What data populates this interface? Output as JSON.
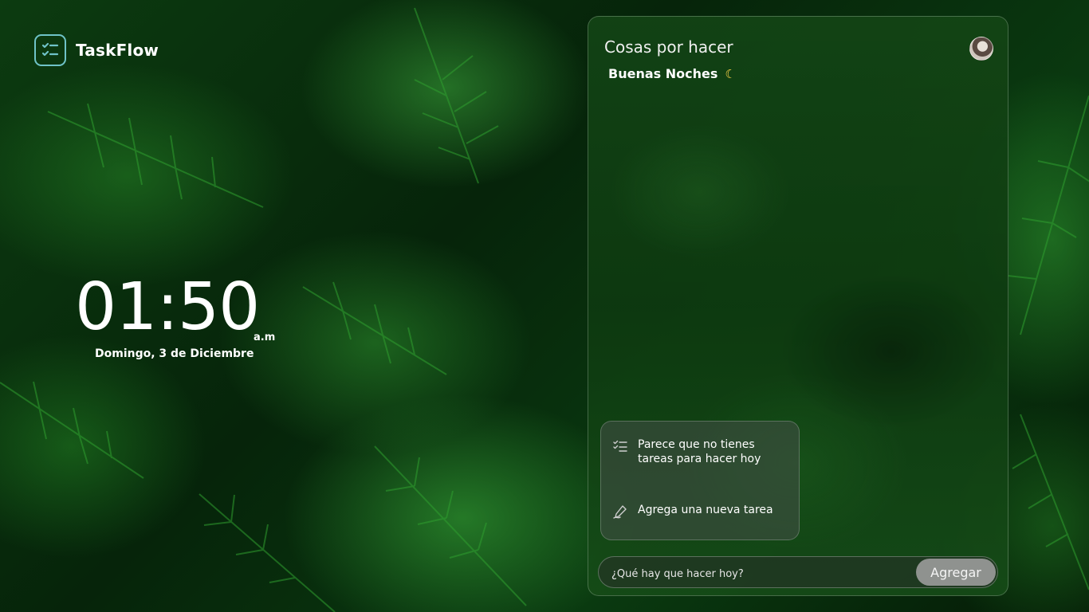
{
  "app": {
    "name": "TaskFlow",
    "logo_icon": "checklist-icon"
  },
  "clock": {
    "time": "01:50",
    "period": "a.m",
    "date": "Domingo, 3 de Diciembre"
  },
  "panel": {
    "title": "Cosas por hacer",
    "greeting": "Buenas Noches",
    "greeting_icon": "moon-icon",
    "avatar_icon": "user-avatar"
  },
  "empty_state": {
    "message": "Parece que no tienes tareas para hacer hoy",
    "message_icon": "checklist-icon",
    "hint": "Agrega una nueva tarea",
    "hint_icon": "pen-icon"
  },
  "composer": {
    "placeholder": "¿Qué hay que hacer hoy?",
    "value": "",
    "button_label": "Agregar"
  },
  "colors": {
    "logo_accent": "#6fc3c8",
    "moon": "#ffd54a",
    "button_bg": "#8f928f"
  }
}
